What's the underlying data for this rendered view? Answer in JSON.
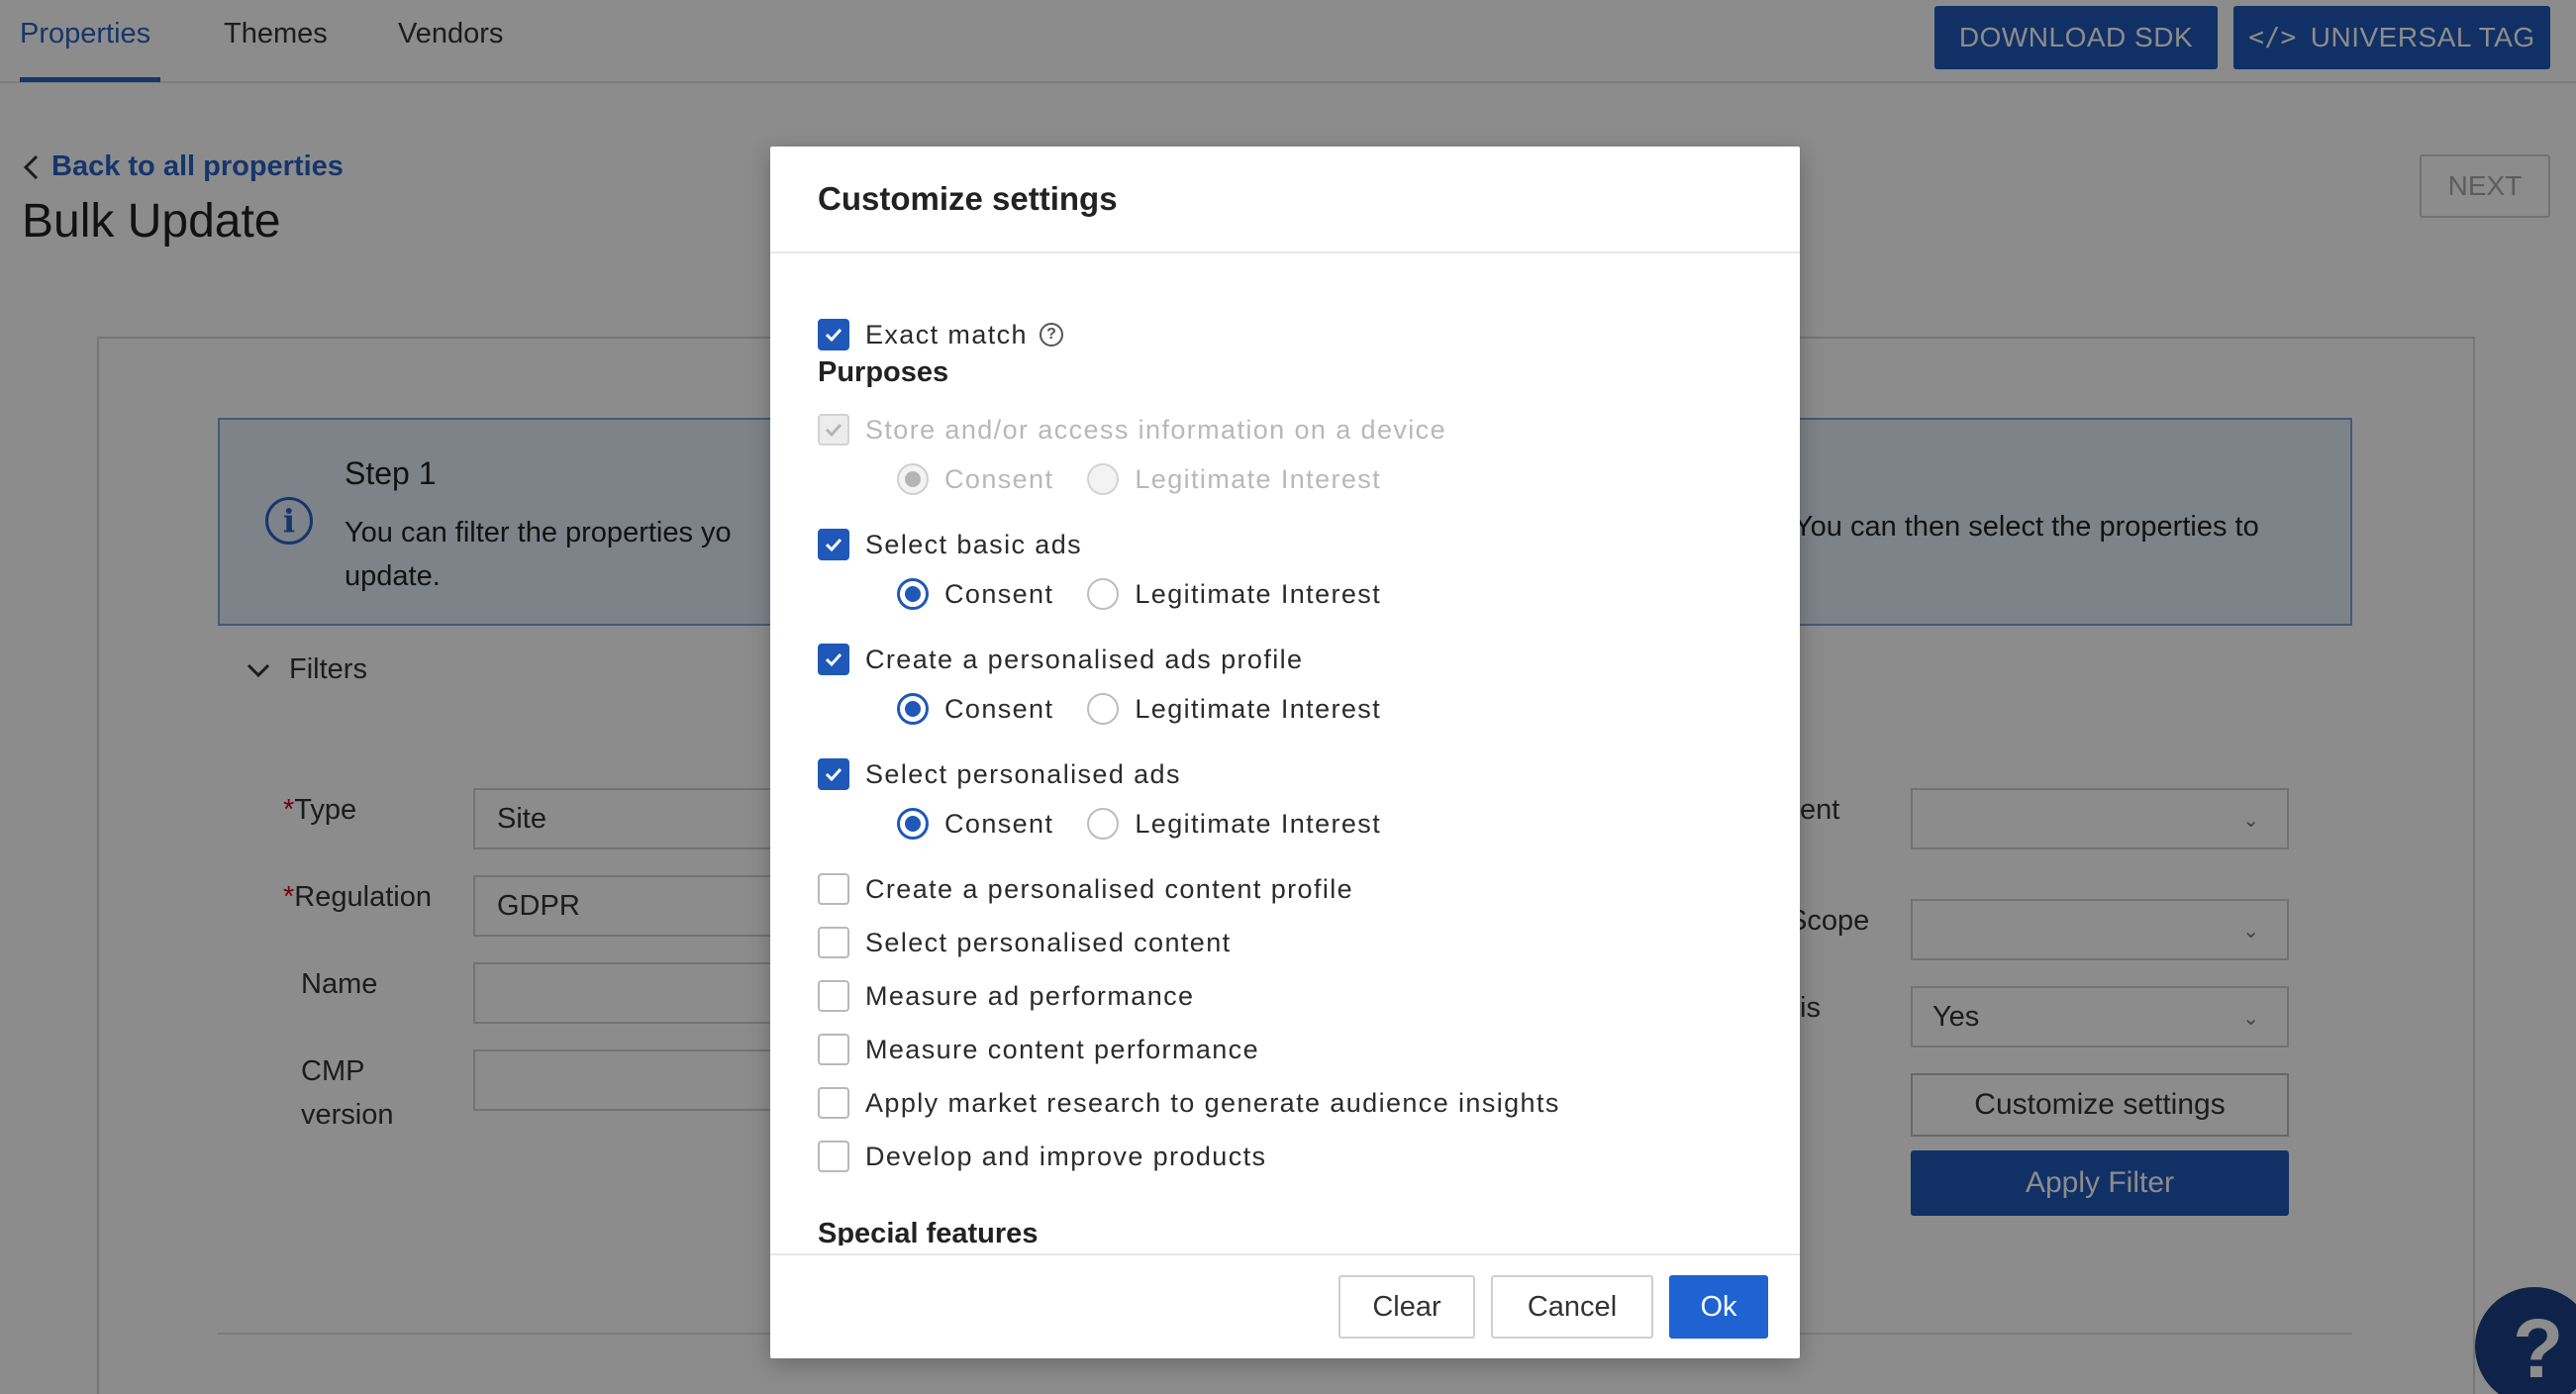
{
  "nav": {
    "tabs": [
      {
        "label": "Properties",
        "active": true
      },
      {
        "label": "Themes",
        "active": false
      },
      {
        "label": "Vendors",
        "active": false
      }
    ],
    "download_sdk": "DOWNLOAD SDK",
    "universal_tag": "UNIVERSAL TAG"
  },
  "page": {
    "back_link": "Back to all properties",
    "title": "Bulk Update",
    "next": "NEXT"
  },
  "step": {
    "title": "Step 1",
    "text_left": "You can filter the properties yo",
    "text_right": "You can then select the properties to",
    "text_line2": "update."
  },
  "filters": {
    "label": "Filters",
    "type_label": "Type",
    "type_value": "Site",
    "regulation_label": "Regulation",
    "regulation_value": "GDPR",
    "name_label": "Name",
    "cmp_label_1": "CMP",
    "cmp_label_2": "version",
    "right_label_1": "ent",
    "right_label_2": "Scope",
    "right_label_3": "is",
    "right_select_3": "Yes",
    "customize_button": "Customize settings",
    "apply_button": "Apply Filter"
  },
  "modal": {
    "title": "Customize settings",
    "exact_match": "Exact match",
    "purposes_header": "Purposes",
    "consent_label": "Consent",
    "li_label": "Legitimate Interest",
    "purposes": [
      {
        "label": "Store and/or access information on a device",
        "checked": true,
        "disabled": true,
        "basis": "consent"
      },
      {
        "label": "Select basic ads",
        "checked": true,
        "disabled": false,
        "basis": "consent"
      },
      {
        "label": "Create a personalised ads profile",
        "checked": true,
        "disabled": false,
        "basis": "consent"
      },
      {
        "label": "Select personalised ads",
        "checked": true,
        "disabled": false,
        "basis": "consent"
      },
      {
        "label": "Create a personalised content profile",
        "checked": false
      },
      {
        "label": "Select personalised content",
        "checked": false
      },
      {
        "label": "Measure ad performance",
        "checked": false
      },
      {
        "label": "Measure content performance",
        "checked": false
      },
      {
        "label": "Apply market research to generate audience insights",
        "checked": false
      },
      {
        "label": "Develop and improve products",
        "checked": false
      }
    ],
    "special_features_header": "Special features",
    "clear": "Clear",
    "cancel": "Cancel",
    "ok": "Ok"
  },
  "colors": {
    "accent": "#1f58b8",
    "link": "#2a62c5",
    "fab": "#1d3f87"
  },
  "icons": {
    "help_fab": "?"
  }
}
